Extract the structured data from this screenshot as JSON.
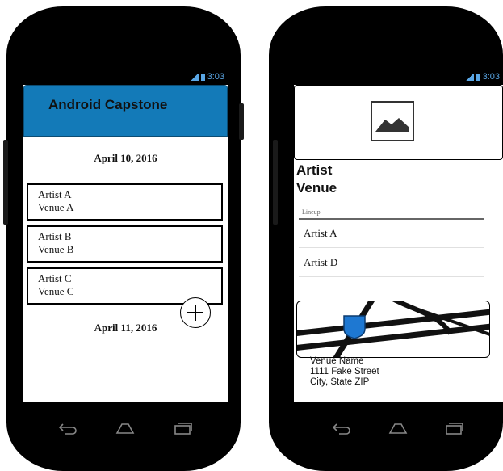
{
  "status_bar": {
    "time": "3:03"
  },
  "left_screen": {
    "app_title": "Android Capstone",
    "dates": [
      "April 10, 2016",
      "April 11, 2016"
    ],
    "events": [
      {
        "artist": "Artist A",
        "venue": "Venue A"
      },
      {
        "artist": "Artist B",
        "venue": "Venue B"
      },
      {
        "artist": "Artist C",
        "venue": "Venue C"
      }
    ],
    "fab_icon": "plus-icon"
  },
  "right_screen": {
    "hero_icon": "image-placeholder-icon",
    "artist": "Artist",
    "venue": "Venue",
    "lineup_label": "Lineup",
    "lineup": [
      "Artist A",
      "Artist D"
    ],
    "map_icon": "map-icon",
    "venue_name": "Venue Name",
    "street": "1111 Fake Street",
    "city": "City, State ZIP"
  },
  "nav_icons": [
    "back-icon",
    "home-icon",
    "recents-icon"
  ],
  "colors": {
    "app_bar": "#137ab8",
    "status_icon": "#5aa7e6",
    "map_marker": "#1e78d2"
  }
}
